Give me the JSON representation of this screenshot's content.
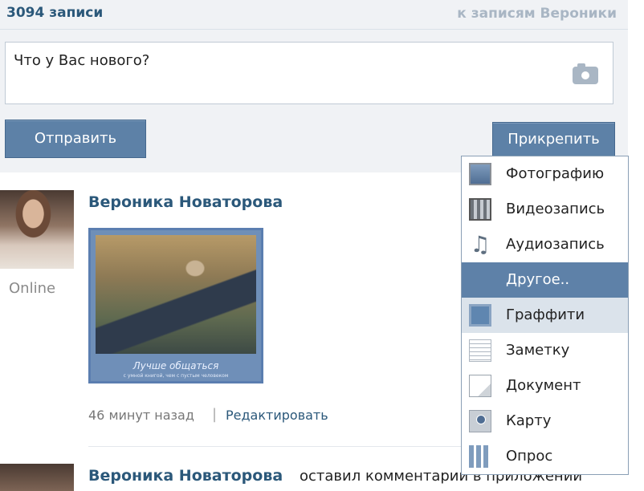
{
  "header": {
    "count_label": "3094 записи",
    "to_wall_link": "к записям Вероники"
  },
  "composer": {
    "placeholder": "Что у Вас нового?",
    "send_label": "Отправить",
    "attach_label": "Прикрепить"
  },
  "attach_menu": {
    "items": [
      {
        "label": "Фотографию",
        "icon": "photo-icon"
      },
      {
        "label": "Видеозапись",
        "icon": "video-icon"
      },
      {
        "label": "Аудиозапись",
        "icon": "audio-icon"
      },
      {
        "label": "Другое..",
        "icon": ""
      },
      {
        "label": "Граффити",
        "icon": "graffiti-icon"
      },
      {
        "label": "Заметку",
        "icon": "note-icon"
      },
      {
        "label": "Документ",
        "icon": "document-icon"
      },
      {
        "label": "Карту",
        "icon": "map-icon"
      },
      {
        "label": "Опрос",
        "icon": "poll-icon"
      }
    ]
  },
  "post": {
    "author": "Вероника Новаторова",
    "status": "Online",
    "image_caption": "Лучше общаться",
    "image_subcaption": "с умной книгой, чем с пустым человеком",
    "time": "46 минут назад",
    "separator": "|",
    "edit_link": "Редактировать"
  },
  "post2": {
    "author": "Вероника Новаторова",
    "action": "оставил комментарий в приложении"
  }
}
